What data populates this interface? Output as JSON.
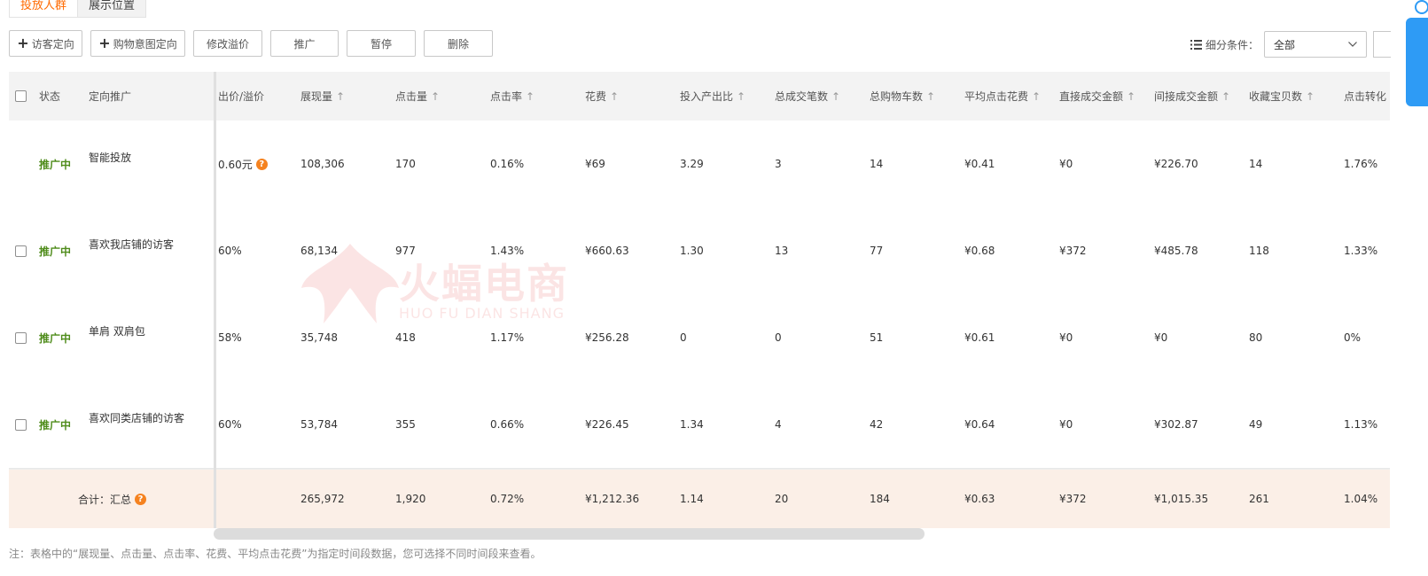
{
  "tabs": [
    "投放人群",
    "展示位置"
  ],
  "toolbar": {
    "plus_icon": "+",
    "visitor_target": "访客定向",
    "purchase_intent": "购物意图定向",
    "modify_premium": "修改溢价",
    "promote": "推广",
    "pause": "暂停",
    "delete": "删除"
  },
  "filter": {
    "label": "细分条件：",
    "value": "全部",
    "icon": "list-icon"
  },
  "table": {
    "sort_arrow": "↑",
    "help_glyph": "?",
    "headers": {
      "status": "状态",
      "target": "定向推广",
      "bid": "出价/溢价",
      "cols": [
        "展现量",
        "点击量",
        "点击率",
        "花费",
        "投入产出比",
        "总成交笔数",
        "总购物车数",
        "平均点击花费",
        "直接成交金额",
        "间接成交金额",
        "收藏宝贝数",
        "点击转化"
      ]
    },
    "rows": [
      {
        "status": "推广中",
        "name": "智能投放",
        "bid": "0.60元",
        "values": [
          "108,306",
          "170",
          "0.16%",
          "¥69",
          "3.29",
          "3",
          "14",
          "¥0.41",
          "¥0",
          "¥226.70",
          "14",
          "1.76%"
        ]
      },
      {
        "status": "推广中",
        "name": "喜欢我店铺的访客",
        "bid": "60%",
        "values": [
          "68,134",
          "977",
          "1.43%",
          "¥660.63",
          "1.30",
          "13",
          "77",
          "¥0.68",
          "¥372",
          "¥485.78",
          "118",
          "1.33%"
        ]
      },
      {
        "status": "推广中",
        "name": "单肩 双肩包",
        "bid": "58%",
        "values": [
          "35,748",
          "418",
          "1.17%",
          "¥256.28",
          "0",
          "0",
          "51",
          "¥0.61",
          "¥0",
          "¥0",
          "80",
          "0%"
        ]
      },
      {
        "status": "推广中",
        "name": "喜欢同类店铺的访客",
        "bid": "60%",
        "values": [
          "53,784",
          "355",
          "0.66%",
          "¥226.45",
          "1.34",
          "4",
          "42",
          "¥0.64",
          "¥0",
          "¥302.87",
          "49",
          "1.13%"
        ]
      }
    ],
    "total": {
      "label": "合计：汇总",
      "values": [
        "265,972",
        "1,920",
        "0.72%",
        "¥1,212.36",
        "1.14",
        "20",
        "184",
        "¥0.63",
        "¥372",
        "¥1,015.35",
        "261",
        "1.04%"
      ]
    }
  },
  "note": "注：表格中的“展现量、点击量、点击率、花费、平均点击花费”为指定时间段数据，您可选择不同时间段来查看。",
  "watermark": {
    "cn": "火蝠电商",
    "en": "HUO FU DIAN SHANG"
  },
  "colors": {
    "accent": "#ff6a00",
    "status_green": "#4f8c1b",
    "help_orange": "#f5821f",
    "total_bg": "#fbefe7",
    "side_blue": "#2e9bf5"
  }
}
